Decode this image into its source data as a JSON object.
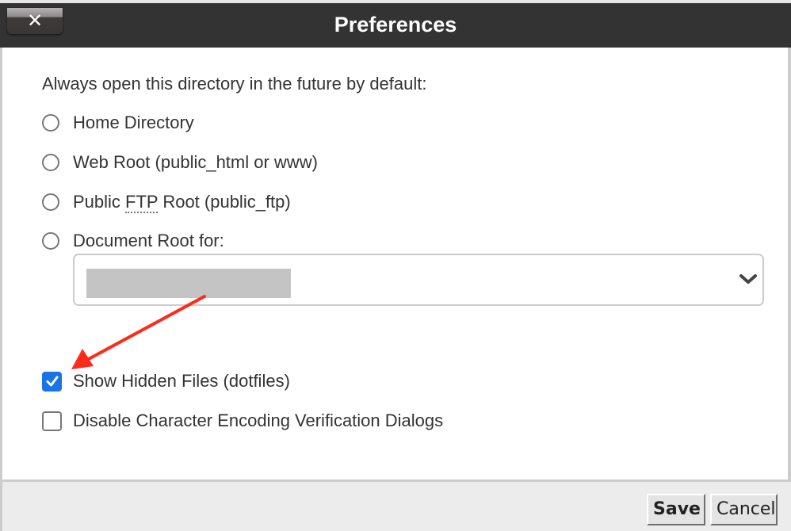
{
  "dialog": {
    "title": "Preferences",
    "close_icon": "close-x-icon",
    "close_glyph": "✕"
  },
  "directory": {
    "prompt": "Always open this directory in the future by default:",
    "options": [
      {
        "label": "Home Directory",
        "selected": false
      },
      {
        "label": "Web Root (public_html or www)",
        "selected": false
      },
      {
        "label_before": "Public ",
        "label_abbr": "FTP",
        "label_after": " Root (public_ftp)",
        "selected": false
      },
      {
        "label": "Document Root for:",
        "selected": false
      }
    ],
    "document_root_select": {
      "value": "",
      "value_redacted": true,
      "dropdown_icon": "chevron-down-icon"
    }
  },
  "checkboxes": [
    {
      "label": "Show Hidden Files (dotfiles)",
      "checked": true
    },
    {
      "label": "Disable Character Encoding Verification Dialogs",
      "checked": false
    }
  ],
  "annotation": {
    "type": "arrow",
    "color": "#ff2a1a",
    "points_to": "Show Hidden Files (dotfiles)"
  },
  "footer": {
    "save_label": "Save",
    "cancel_label": "Cancel"
  },
  "colors": {
    "header_bg": "#333333",
    "checkbox_accent": "#1a73e8",
    "footer_bg": "#ececec"
  }
}
